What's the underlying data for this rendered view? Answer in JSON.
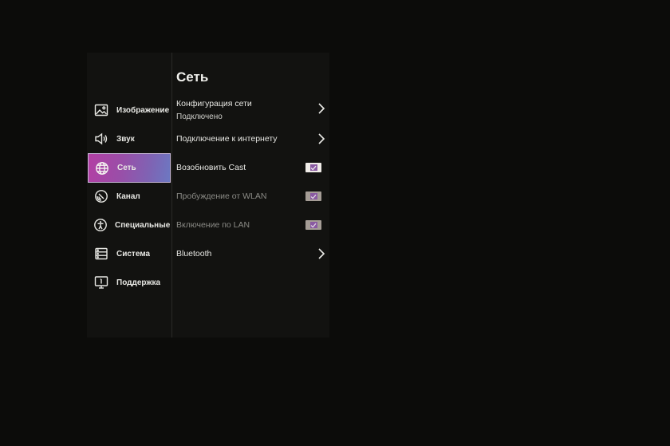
{
  "sidebar": {
    "items": [
      {
        "label": "Изображение",
        "icon": "picture-icon",
        "active": false
      },
      {
        "label": "Звук",
        "icon": "speaker-icon",
        "active": false
      },
      {
        "label": "Сеть",
        "icon": "globe-icon",
        "active": true
      },
      {
        "label": "Канал",
        "icon": "channel-icon",
        "active": false
      },
      {
        "label": "Специальные…",
        "icon": "accessibility-icon",
        "active": false
      },
      {
        "label": "Система",
        "icon": "system-icon",
        "active": false
      },
      {
        "label": "Поддержка",
        "icon": "support-icon",
        "active": false
      }
    ]
  },
  "main": {
    "title": "Сеть",
    "rows": [
      {
        "label": "Конфигурация сети",
        "sub": "Подключено",
        "control": "chevron",
        "enabled": true
      },
      {
        "label": "Подключение к интернету",
        "control": "chevron",
        "enabled": true
      },
      {
        "label": "Возобновить Cast",
        "control": "checkbox",
        "checked": true,
        "enabled": true
      },
      {
        "label": "Пробуждение от WLAN",
        "control": "checkbox",
        "checked": true,
        "enabled": false
      },
      {
        "label": "Включение по LAN",
        "control": "checkbox",
        "checked": true,
        "enabled": false
      },
      {
        "label": "Bluetooth",
        "control": "chevron",
        "enabled": true
      }
    ]
  },
  "colors": {
    "accent_gradient_start": "#b33fa4",
    "accent_gradient_end": "#6c78c2",
    "checkbox_mark": "#8a5aa2",
    "background": "#0c0c0a"
  }
}
